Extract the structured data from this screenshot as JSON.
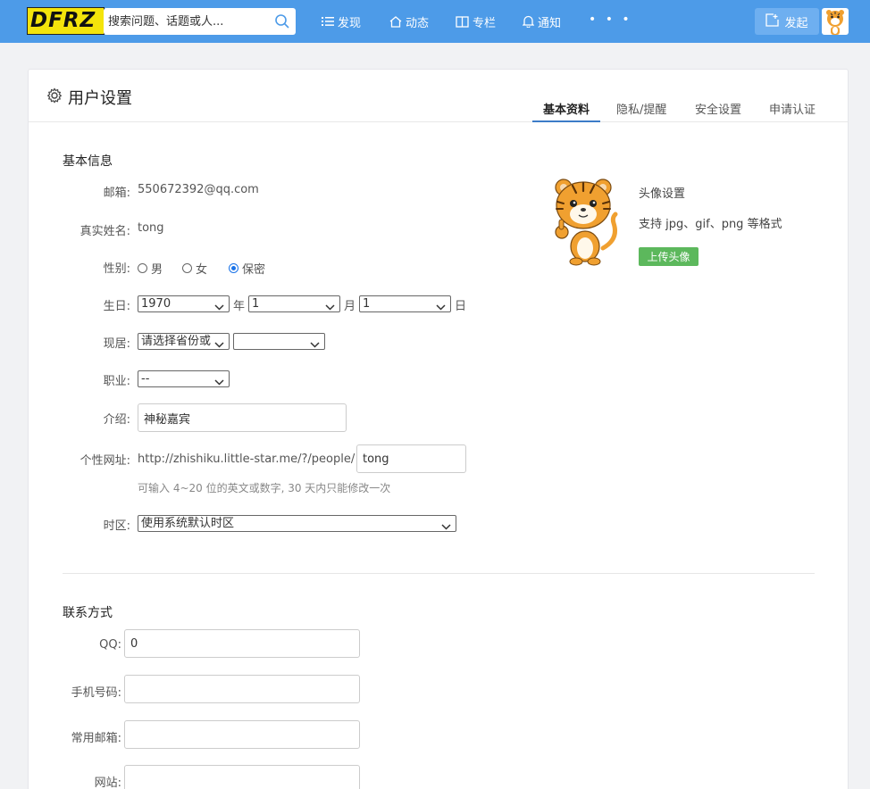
{
  "header": {
    "logo_text": "DFRZ",
    "search_placeholder": "搜索问题、话题或人...",
    "nav": [
      {
        "label": "发现",
        "icon": "list-icon"
      },
      {
        "label": "动态",
        "icon": "home-icon"
      },
      {
        "label": "专栏",
        "icon": "book-icon"
      },
      {
        "label": "通知",
        "icon": "bell-icon"
      }
    ],
    "more": "• • •",
    "publish_label": "发起"
  },
  "page": {
    "title": "用户设置",
    "tabs": [
      "基本资料",
      "隐私/提醒",
      "安全设置",
      "申请认证"
    ],
    "active_tab": "基本资料"
  },
  "basic": {
    "section_title": "基本信息",
    "email_label": "邮箱:",
    "email_value": "550672392@qq.com",
    "realname_label": "真实姓名:",
    "realname_value": "tong",
    "gender_label": "性别:",
    "gender_options": [
      "男",
      "女",
      "保密"
    ],
    "gender_selected": "保密",
    "birthday_label": "生日:",
    "birth_year": "1970",
    "birth_year_unit": "年",
    "birth_month": "1",
    "birth_month_unit": "月",
    "birth_day": "1",
    "birth_day_unit": "日",
    "residence_label": "现居:",
    "province_placeholder": "请选择省份或",
    "city_value": "",
    "job_label": "职业:",
    "job_value": "--",
    "intro_label": "介绍:",
    "intro_value": "神秘嘉宾",
    "url_label": "个性网址:",
    "url_prefix": "http://zhishiku.little-star.me/?/people/",
    "url_value": "tong",
    "url_hint": "可输入 4~20 位的英文或数字, 30 天内只能修改一次",
    "timezone_label": "时区:",
    "timezone_value": "使用系统默认时区"
  },
  "avatar": {
    "title": "头像设置",
    "formats": "支持 jpg、gif、png 等格式",
    "upload_label": "上传头像"
  },
  "contact": {
    "section_title": "联系方式",
    "qq_label": "QQ:",
    "qq_value": "0",
    "phone_label": "手机号码:",
    "phone_value": "",
    "email_label": "常用邮箱:",
    "email_value": "",
    "website_label": "网站:",
    "website_value": ""
  },
  "colors": {
    "topbar": "#4d9be8",
    "upload": "#5cb85c",
    "tab_active": "#3c7cc8"
  }
}
